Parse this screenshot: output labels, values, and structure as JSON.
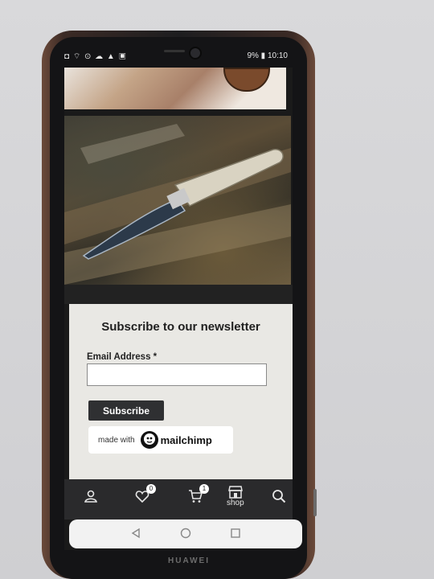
{
  "status_bar": {
    "left_icons": "◘ ⌔ ⊙ ☁ ▲ ▣",
    "battery": "9%",
    "time": "10:10"
  },
  "newsletter": {
    "title": "Subscribe to our newsletter",
    "email_label": "Email Address *",
    "email_value": "",
    "subscribe_label": "Subscribe",
    "made_with": "made with",
    "brand": "mailchimp"
  },
  "bottom_nav": {
    "account_icon": "user-icon",
    "wishlist_icon": "heart-icon",
    "wishlist_count": "0",
    "cart_icon": "cart-icon",
    "cart_count": "1",
    "shop_icon": "store-icon",
    "shop_label": "shop",
    "search_icon": "search-icon"
  },
  "device": {
    "brand": "HUAWEI"
  },
  "colors": {
    "button_dark": "#2f3032",
    "nav_bg": "#2a2a2c",
    "panel_bg": "#e9e8e4"
  }
}
